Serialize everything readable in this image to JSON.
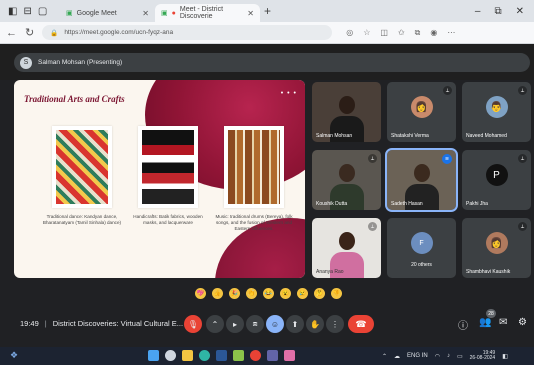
{
  "browser": {
    "tabs": [
      {
        "label": "Google Meet",
        "active": false
      },
      {
        "label": "Meet - District Discoverie",
        "active": true
      }
    ],
    "new_tab": "+",
    "url": "https://meet.google.com/ucn-fyqz-ana",
    "window_controls": [
      "–",
      "⧉",
      "✕"
    ]
  },
  "meet": {
    "presenter_label": "Salman Mohsan (Presenting)",
    "slide": {
      "title": "Traditional Arts and Crafts",
      "menu": "• • •",
      "captions": [
        "Traditional dance: Kandyan dance, Bharatanatyam (Tamil Sinhala) dance)",
        "Handicrafts: Batik fabrics, wooden masks, and lacquerware",
        "Music: traditional drums (Bereya), folk songs, and the fusion of Western and Eastern influences."
      ]
    },
    "participants": [
      {
        "name": "Salman Mohsan",
        "video": true,
        "muted": false
      },
      {
        "name": "Shatakshi Verma",
        "video": false,
        "muted": true
      },
      {
        "name": "Naveed Mohamed",
        "video": false,
        "muted": true
      },
      {
        "name": "Koushik Dutta",
        "video": true,
        "muted": true
      },
      {
        "name": "Sadeth Hasan",
        "video": true,
        "muted": false,
        "speaking": true
      },
      {
        "name": "Pakhi Jha",
        "video": false,
        "muted": true,
        "initial": "P"
      },
      {
        "name": "Ananya Rao",
        "video": true,
        "muted": true
      },
      {
        "name": "20 others",
        "video": false,
        "muted": false
      },
      {
        "name": "Shambhavi Kaushik",
        "video": false,
        "muted": true
      }
    ],
    "reactions": [
      "💖",
      "👍",
      "🎉",
      "👏",
      "😂",
      "😮",
      "😢",
      "🤔",
      "👎"
    ],
    "meeting_time": "19:49",
    "meeting_title": "District Discoveries: Virtual Cultural E...",
    "participants_count": "28",
    "colors": {
      "leave": "#ea4335",
      "accent": "#8ab4f8",
      "slide_accent": "#8f1435"
    }
  },
  "taskbar": {
    "clock_time": "19:49",
    "clock_date": "26-08-2024",
    "lang": "ENG IN"
  }
}
